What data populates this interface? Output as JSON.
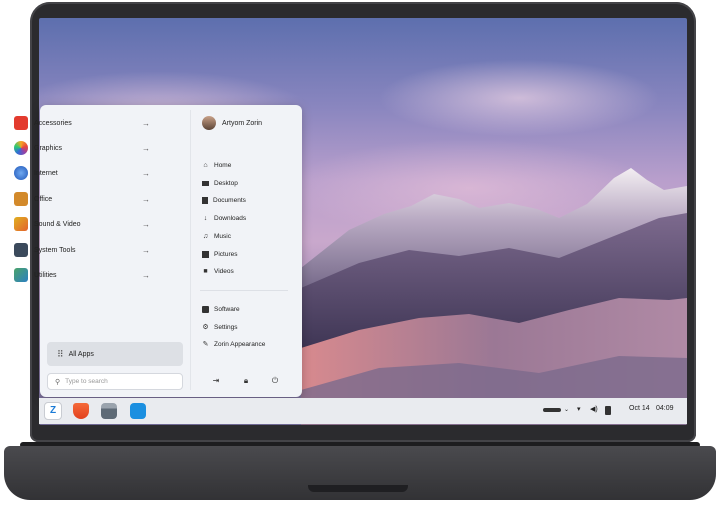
{
  "menu": {
    "categories": [
      {
        "label": "Accessories",
        "icon": "toolbox-icon",
        "color": "#e33b2e"
      },
      {
        "label": "Graphics",
        "icon": "palette-icon",
        "color": "#f5a623"
      },
      {
        "label": "Internet",
        "icon": "globe-icon",
        "color": "#2f6fd6"
      },
      {
        "label": "Office",
        "icon": "briefcase-icon",
        "color": "#d38a2b"
      },
      {
        "label": "Sound & Video",
        "icon": "media-icon",
        "color": "#e0b020"
      },
      {
        "label": "System Tools",
        "icon": "monitor-icon",
        "color": "#3b4a5c"
      },
      {
        "label": "Utilities",
        "icon": "tools-icon",
        "color": "#4aa36a"
      }
    ],
    "all_apps_label": "All Apps",
    "search_placeholder": "Type to search",
    "user_name": "Artyom Zorin",
    "places": [
      {
        "label": "Home",
        "icon": "home-icon"
      },
      {
        "label": "Desktop",
        "icon": "desktop-icon"
      },
      {
        "label": "Documents",
        "icon": "documents-icon"
      },
      {
        "label": "Downloads",
        "icon": "download-icon"
      },
      {
        "label": "Music",
        "icon": "music-icon"
      },
      {
        "label": "Pictures",
        "icon": "pictures-icon"
      },
      {
        "label": "Videos",
        "icon": "videos-icon"
      }
    ],
    "system": [
      {
        "label": "Software",
        "icon": "software-icon"
      },
      {
        "label": "Settings",
        "icon": "gear-icon"
      },
      {
        "label": "Zorin Appearance",
        "icon": "appearance-icon"
      }
    ],
    "power_buttons": [
      "logout-icon",
      "lock-icon",
      "power-icon"
    ]
  },
  "taskbar": {
    "apps": [
      "zorin-menu-icon",
      "brave-browser-icon",
      "files-icon",
      "software-store-icon"
    ],
    "date": "Oct 14",
    "time": "04:09"
  },
  "colors": {
    "accent": "#1b7bd6",
    "menu_bg": "#f1f3f7",
    "taskbar_bg": "#e9ebef"
  }
}
